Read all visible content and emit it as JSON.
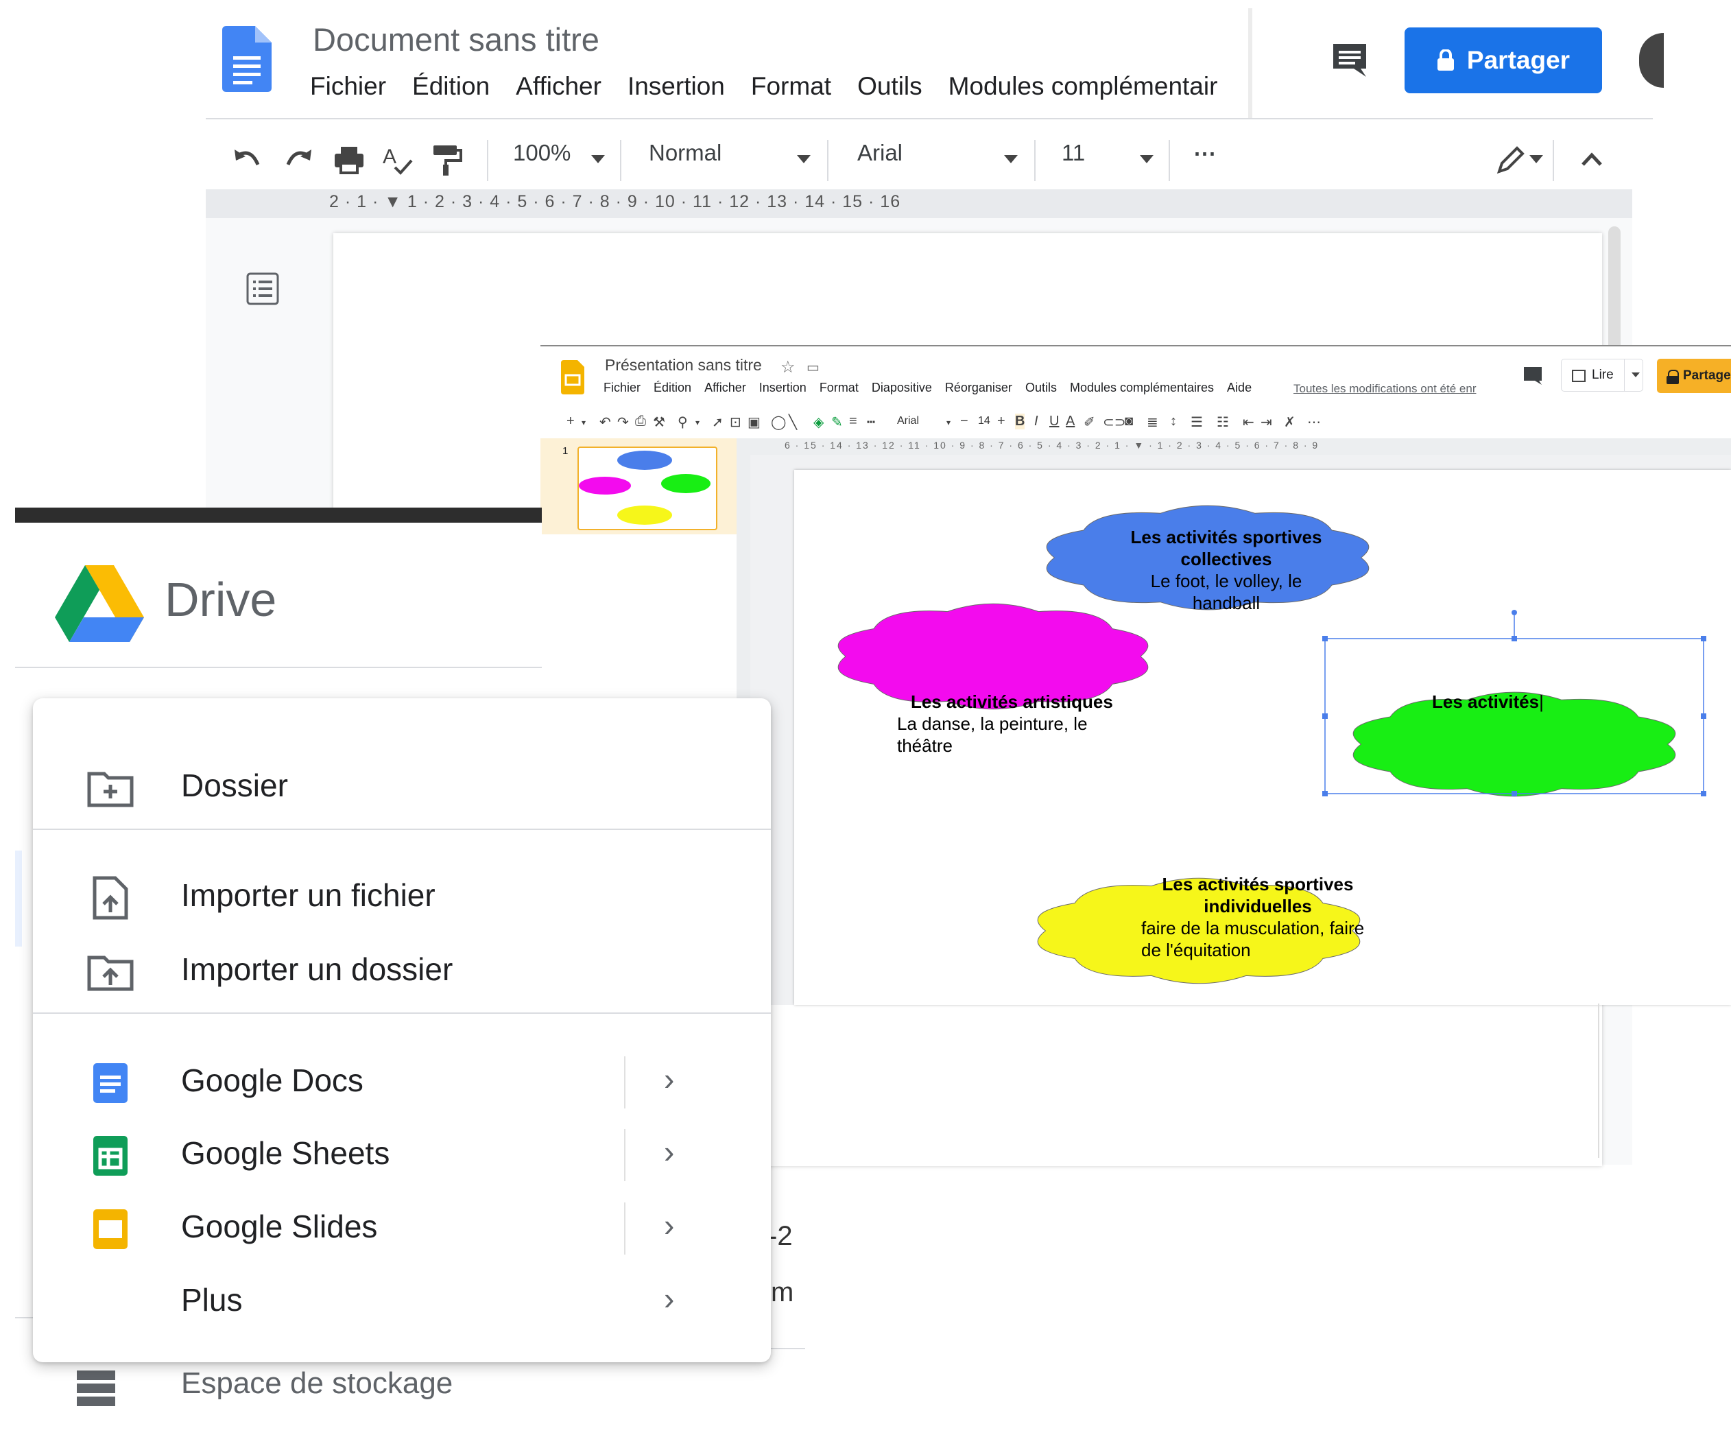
{
  "docs": {
    "title": "Document sans titre",
    "menu": [
      "Fichier",
      "Édition",
      "Afficher",
      "Insertion",
      "Format",
      "Outils",
      "Modules complémentair"
    ],
    "share_label": "Partager",
    "zoom": "100%",
    "style": "Normal",
    "font": "Arial",
    "size": "11",
    "more": "⋯",
    "ruler": "2  ·  1  ·   ▼  1  ·  2  ·  3  ·  4  ·  5  ·  6  ·  7  ·  8  ·  9  ·  10  ·  11  ·  12  ·  13  ·  14  ·  15  ·  16",
    "colors": {
      "share": "#1a73e8",
      "docs_blue": "#4285f4"
    }
  },
  "slides": {
    "title": "Présentation sans titre",
    "menu": [
      "Fichier",
      "Édition",
      "Afficher",
      "Insertion",
      "Format",
      "Diapositive",
      "Réorganiser",
      "Outils",
      "Modules complémentaires",
      "Aide"
    ],
    "saved": "Toutes les modifications ont été enr",
    "lire_label": "Lire",
    "share_label": "Partage",
    "font": "Arial",
    "font_size": "14",
    "slide_number": "1",
    "ruler": "6 · 15 · 14 · 13 · 12 · 11 · 10 · 9 · 8 · 7 · 6 · 5 · 4 · 3 · 2 · 1 · ▼ · 1 · 2 · 3 · 4 · 5 · 6 · 7 · 8 · 9",
    "clouds": [
      {
        "name": "cloud-collectives",
        "color": "#4a7eea",
        "lines": [
          {
            "t": "Les activités sportives",
            "b": true
          },
          {
            "t": "collectives",
            "b": true
          },
          {
            "t": "Le foot, le volley, le handball",
            "b": false
          }
        ]
      },
      {
        "name": "cloud-artistiques",
        "color": "#f30bee",
        "lines": [
          {
            "t": "Les activités artistiques",
            "b": true
          },
          {
            "t": "La danse, la peinture, le",
            "b": false
          },
          {
            "t": "théâtre",
            "b": false
          }
        ]
      },
      {
        "name": "cloud-green",
        "color": "#18ee14",
        "lines": [
          {
            "t": "Les activités",
            "b": true
          }
        ]
      },
      {
        "name": "cloud-individuelles",
        "color": "#f6f61a",
        "lines": [
          {
            "t": "Les activités sportives",
            "b": true
          },
          {
            "t": "individuelles",
            "b": true
          },
          {
            "t": "faire de la musculation, faire",
            "b": false
          },
          {
            "t": "de l'équitation",
            "b": false
          }
        ]
      }
    ]
  },
  "drive": {
    "brand": "Drive",
    "storage_label": "Espace de stockage",
    "behind_text": [
      "-2",
      "m"
    ],
    "menu": {
      "folder": "Dossier",
      "upload_file": "Importer un fichier",
      "upload_folder": "Importer un dossier",
      "docs": "Google Docs",
      "sheets": "Google Sheets",
      "slides": "Google Slides",
      "more": "Plus"
    },
    "colors": {
      "docs": "#4285f4",
      "sheets": "#0f9d58",
      "slides": "#f4b400"
    }
  }
}
